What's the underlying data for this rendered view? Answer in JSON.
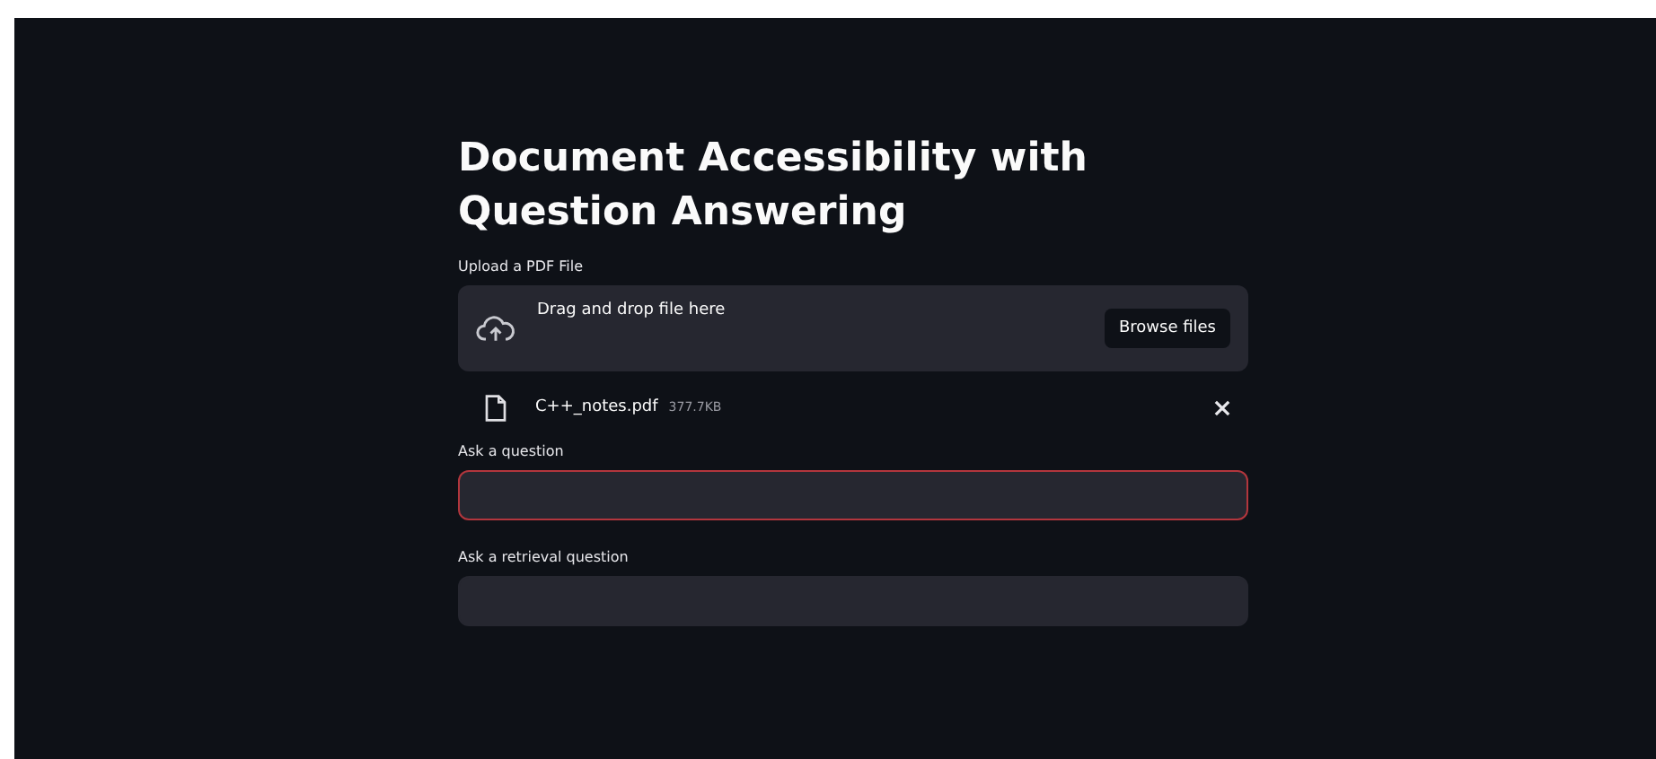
{
  "title": "Document Accessibility with Question Answering",
  "uploader": {
    "label": "Upload a PDF File",
    "dropzone_text": "Drag and drop file here",
    "button": "Browse files"
  },
  "file": {
    "name": "C++_notes.pdf",
    "size": "377.7KB"
  },
  "fields": [
    {
      "label": "Ask a question",
      "focused": true
    },
    {
      "label": "Ask a retrieval question",
      "focused": false
    }
  ]
}
